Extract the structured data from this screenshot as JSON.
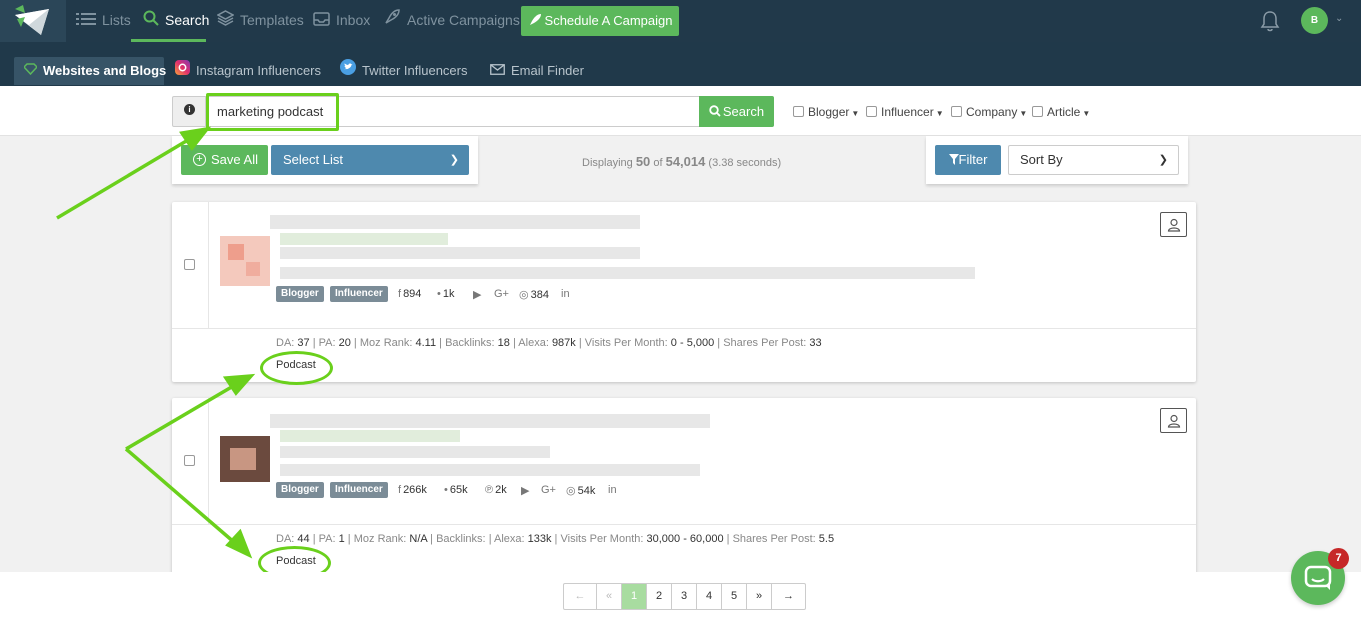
{
  "nav": {
    "items": [
      {
        "label": "Lists",
        "icon": "list-icon"
      },
      {
        "label": "Search",
        "icon": "search-icon"
      },
      {
        "label": "Templates",
        "icon": "layers-icon"
      },
      {
        "label": "Inbox",
        "icon": "inbox-icon"
      },
      {
        "label": "Active Campaigns",
        "icon": "rocket-icon"
      }
    ],
    "active": "Search",
    "schedule_button": "Schedule A Campaign",
    "user_initial": "B"
  },
  "subnav": {
    "items": [
      {
        "label": "Websites and Blogs",
        "icon": "gem-icon"
      },
      {
        "label": "Instagram Influencers",
        "icon": "instagram-icon"
      },
      {
        "label": "Twitter Influencers",
        "icon": "twitter-icon"
      },
      {
        "label": "Email Finder",
        "icon": "envelope-icon"
      }
    ],
    "active": "Websites and Blogs"
  },
  "search": {
    "value": "marketing podcast",
    "button_label": "Search",
    "filters": [
      "Blogger",
      "Influencer",
      "Company",
      "Article"
    ]
  },
  "toolbar": {
    "save_all": "Save All",
    "select_list": "Select List",
    "displaying_prefix": "Displaying",
    "displaying_count": "50",
    "displaying_of": "of",
    "displaying_total": "54,014",
    "displaying_time": "(3.38 seconds)",
    "filter_button": "Filter",
    "sort_by": "Sort By"
  },
  "results": [
    {
      "tags": [
        "Blogger",
        "Influencer"
      ],
      "stats": [
        {
          "icon": "facebook-icon",
          "glyph": "f",
          "value": "894"
        },
        {
          "icon": "twitter-icon",
          "glyph": "•",
          "value": "1k"
        },
        {
          "icon": "youtube-icon",
          "glyph": "▶",
          "value": ""
        },
        {
          "icon": "google-plus-icon",
          "glyph": "G+",
          "value": ""
        },
        {
          "icon": "instagram-icon",
          "glyph": "◎",
          "value": "384"
        },
        {
          "icon": "linkedin-icon",
          "glyph": "in",
          "value": ""
        }
      ],
      "metrics": [
        {
          "label": "DA:",
          "value": "37"
        },
        {
          "label": "PA:",
          "value": "20"
        },
        {
          "label": "Moz Rank:",
          "value": "4.11"
        },
        {
          "label": "Backlinks:",
          "value": "18"
        },
        {
          "label": "Alexa:",
          "value": "987k"
        },
        {
          "label": "Visits Per Month:",
          "value": "0 - 5,000"
        },
        {
          "label": "Shares Per Post:",
          "value": "33"
        }
      ],
      "category": "Podcast"
    },
    {
      "tags": [
        "Blogger",
        "Influencer"
      ],
      "stats": [
        {
          "icon": "facebook-icon",
          "glyph": "f",
          "value": "266k"
        },
        {
          "icon": "twitter-icon",
          "glyph": "•",
          "value": "65k"
        },
        {
          "icon": "pinterest-icon",
          "glyph": "℗",
          "value": "2k"
        },
        {
          "icon": "youtube-icon",
          "glyph": "▶",
          "value": ""
        },
        {
          "icon": "google-plus-icon",
          "glyph": "G+",
          "value": ""
        },
        {
          "icon": "instagram-icon",
          "glyph": "◎",
          "value": "54k"
        },
        {
          "icon": "linkedin-icon",
          "glyph": "in",
          "value": ""
        }
      ],
      "metrics": [
        {
          "label": "DA:",
          "value": "44"
        },
        {
          "label": "PA:",
          "value": "1"
        },
        {
          "label": "Moz Rank:",
          "value": "N/A"
        },
        {
          "label": "Backlinks:",
          "value": ""
        },
        {
          "label": "Alexa:",
          "value": "133k"
        },
        {
          "label": "Visits Per Month:",
          "value": "30,000 - 60,000"
        },
        {
          "label": "Shares Per Post:",
          "value": "5.5"
        }
      ],
      "category": "Podcast"
    }
  ],
  "pagination": [
    "←",
    "«",
    "1",
    "2",
    "3",
    "4",
    "5",
    "»",
    "→"
  ],
  "pagination_active": "1",
  "chat": {
    "badge": "7"
  },
  "colors": {
    "nav_bg": "#21394a",
    "accent_green": "#5cb85c",
    "blue_button": "#4e89ae",
    "annotation_green": "#6ad01c",
    "badge_red": "#c62828"
  }
}
